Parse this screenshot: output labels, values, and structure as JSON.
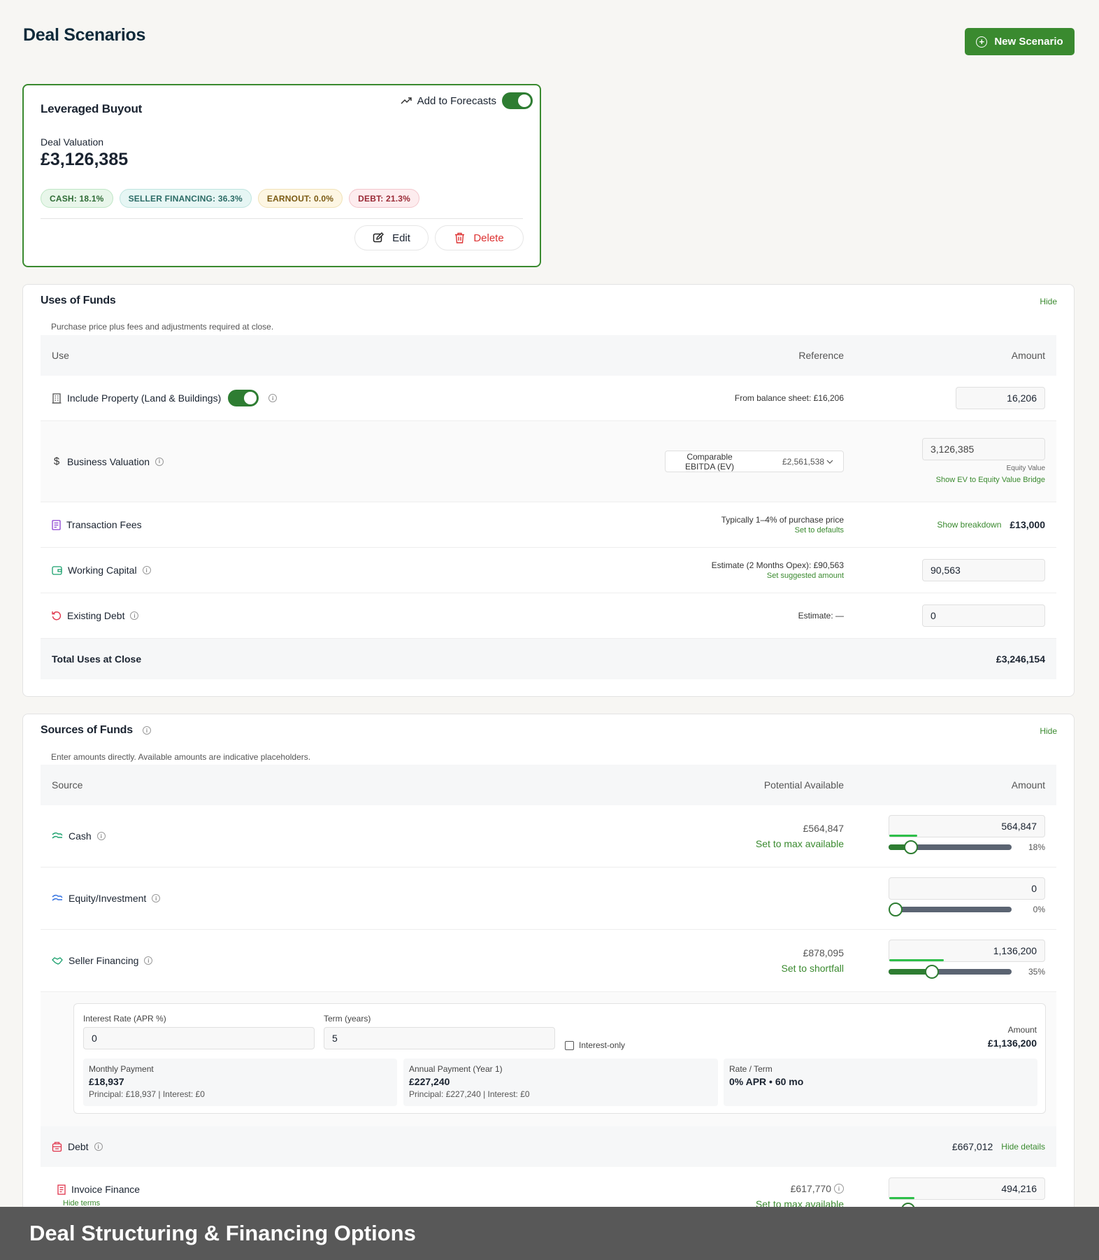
{
  "page": {
    "title": "Deal Scenarios",
    "new_button": "New Scenario"
  },
  "scenario": {
    "name": "Leveraged Buyout",
    "forecast_label": "Add to Forecasts",
    "valuation_label": "Deal Valuation",
    "valuation": "£3,126,385",
    "badges": {
      "cash": "CASH: 18.1%",
      "seller": "SELLER FINANCING: 36.3%",
      "earnout": "EARNOUT: 0.0%",
      "debt": "DEBT: 21.3%"
    },
    "edit": "Edit",
    "delete": "Delete"
  },
  "uses": {
    "title": "Uses of Funds",
    "hide": "Hide",
    "desc": "Purchase price plus fees and adjustments required at close.",
    "headers": {
      "use": "Use",
      "reference": "Reference",
      "amount": "Amount"
    },
    "property": {
      "label": "Include Property (Land & Buildings)",
      "ref": "From balance sheet: £16,206",
      "amount": "16,206"
    },
    "valuation": {
      "label": "Business Valuation",
      "select_label": "Comparable EBITDA (EV)",
      "select_value": "£2,561,538",
      "amount": "3,126,385",
      "sub": "Equity Value",
      "link": "Show EV to Equity Value Bridge"
    },
    "fees": {
      "label": "Transaction Fees",
      "ref": "Typically 1–4% of purchase price",
      "ref_link": "Set to defaults",
      "link": "Show breakdown",
      "amount": "£13,000"
    },
    "wc": {
      "label": "Working Capital",
      "ref": "Estimate (2 Months Opex): £90,563",
      "ref_link": "Set suggested amount",
      "amount": "90,563"
    },
    "debt": {
      "label": "Existing Debt",
      "ref": "Estimate: —",
      "amount": "0"
    },
    "total": {
      "label": "Total Uses at Close",
      "amount": "£3,246,154"
    }
  },
  "sources": {
    "title": "Sources of Funds",
    "hide": "Hide",
    "desc": "Enter amounts directly. Available amounts are indicative placeholders.",
    "headers": {
      "source": "Source",
      "potential": "Potential Available",
      "amount": "Amount"
    },
    "cash": {
      "label": "Cash",
      "potential": "£564,847",
      "action": "Set to max available",
      "amount": "564,847",
      "pct": "18%",
      "level": 0.18
    },
    "equity": {
      "label": "Equity/Investment",
      "amount": "0",
      "pct": "0%",
      "level": 0
    },
    "seller": {
      "label": "Seller Financing",
      "potential": "£878,095",
      "action": "Set to shortfall",
      "amount": "1,136,200",
      "pct": "35%",
      "level": 0.35
    },
    "terms": {
      "rate_label": "Interest Rate (APR %)",
      "rate": "0",
      "term_label": "Term (years)",
      "term": "5",
      "io_label": "Interest-only",
      "amount_label": "Amount",
      "amount": "£1,136,200",
      "monthly_label": "Monthly Payment",
      "monthly": "£18,937",
      "monthly_sub": "Principal: £18,937 | Interest: £0",
      "annual_label": "Annual Payment (Year 1)",
      "annual": "£227,240",
      "annual_sub": "Principal: £227,240 | Interest: £0",
      "rt_label": "Rate / Term",
      "rt": "0% APR • 60 mo"
    },
    "debt": {
      "label": "Debt",
      "amount": "£667,012",
      "link": "Hide details"
    },
    "invoice": {
      "label": "Invoice Finance",
      "hide_terms": "Hide terms",
      "potential": "£617,770",
      "action": "Set to max available",
      "amount": "494,216",
      "level": 0.16
    }
  },
  "footer": {
    "caption": "Deal Structuring & Financing Options"
  },
  "colors": {
    "brand": "#3a8a2f",
    "danger": "#d33333"
  }
}
